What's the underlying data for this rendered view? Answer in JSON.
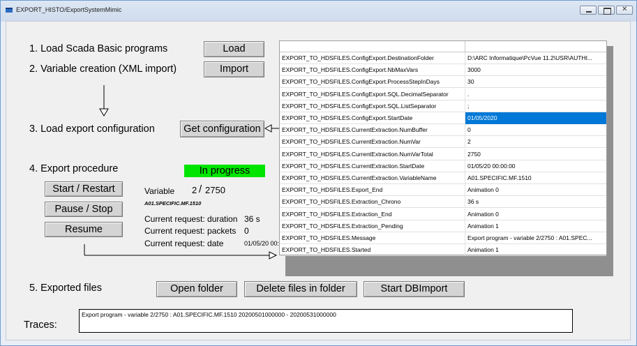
{
  "window": {
    "title": "EXPORT_HISTO/ExportSystemMimic"
  },
  "steps": {
    "step1": "1.  Load Scada Basic programs",
    "step2": "2.  Variable creation (XML import)",
    "step3": "3.  Load export configuration",
    "step4": "4.  Export procedure",
    "step5": "5.  Exported files"
  },
  "buttons": {
    "load": "Load",
    "import": "Import",
    "get_configuration": "Get configuration",
    "start_restart": "Start / Restart",
    "pause_stop": "Pause / Stop",
    "resume": "Resume",
    "open_folder": "Open folder",
    "delete_files": "Delete files in folder",
    "start_dbimport": "Start DBImport"
  },
  "status": {
    "progress": "In progress"
  },
  "variable": {
    "label": "Variable",
    "current": "2",
    "separator": "/",
    "total": "2750",
    "name": "A01.SPECIFIC.MF.1510"
  },
  "request": {
    "duration_label": "Current request: duration",
    "duration_value": "36 s",
    "packets_label": "Current request: packets",
    "packets_value": "0",
    "date_label": "Current request: date",
    "date_value": "01/05/20 00:"
  },
  "config_table": {
    "selected_row": 5,
    "rows": [
      {
        "name": "EXPORT_TO_HDSFILES.ConfigExport.DestinationFolder",
        "value": "D:\\ARC Informatique\\PcVue 11.2\\USR\\AUTHI..."
      },
      {
        "name": "EXPORT_TO_HDSFILES.ConfigExport.NbMaxVars",
        "value": "3000"
      },
      {
        "name": "EXPORT_TO_HDSFILES.ConfigExport.ProcessStepInDays",
        "value": "30"
      },
      {
        "name": "EXPORT_TO_HDSFILES.ConfigExport.SQL.DecimalSeparator",
        "value": "."
      },
      {
        "name": "EXPORT_TO_HDSFILES.ConfigExport.SQL.ListSeparator",
        "value": ";"
      },
      {
        "name": "EXPORT_TO_HDSFILES.ConfigExport.StartDate",
        "value": "01/05/2020"
      },
      {
        "name": "EXPORT_TO_HDSFILES.CurrentExtraction.NumBuffer",
        "value": "0"
      },
      {
        "name": "EXPORT_TO_HDSFILES.CurrentExtraction.NumVar",
        "value": "2"
      },
      {
        "name": "EXPORT_TO_HDSFILES.CurrentExtraction.NumVarTotal",
        "value": "2750"
      },
      {
        "name": "EXPORT_TO_HDSFILES.CurrentExtraction.StartDate",
        "value": "01/05/20 00:00:00"
      },
      {
        "name": "EXPORT_TO_HDSFILES.CurrentExtraction.VariableName",
        "value": "A01.SPECIFIC.MF.1510"
      },
      {
        "name": "EXPORT_TO_HDSFILES.Export_End",
        "value": "Animation 0"
      },
      {
        "name": "EXPORT_TO_HDSFILES.Extraction_Chrono",
        "value": "36 s"
      },
      {
        "name": "EXPORT_TO_HDSFILES.Extraction_End",
        "value": "Animation 0"
      },
      {
        "name": "EXPORT_TO_HDSFILES.Extraction_Pending",
        "value": "Animation 1"
      },
      {
        "name": "EXPORT_TO_HDSFILES.Message",
        "value": "Export program - variable 2/2750 : A01.SPEC..."
      },
      {
        "name": "EXPORT_TO_HDSFILES.Started",
        "value": "Animation 1"
      }
    ]
  },
  "traces": {
    "label": "Traces:",
    "text": "Export program - variable 2/2750 : A01.SPECIFIC.MF.1510 20200501000000 - 20200531000000"
  },
  "colors": {
    "progress": "#00e500",
    "selection": "#0078d7",
    "title_bar": "#dde7f4"
  }
}
